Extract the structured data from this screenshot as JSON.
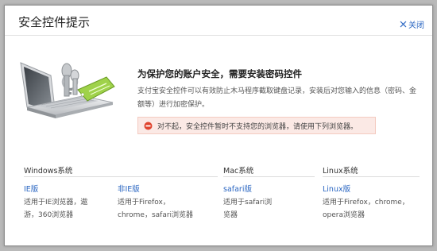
{
  "dialog": {
    "title": "安全控件提示",
    "close_label": "关闭"
  },
  "main": {
    "headline": "为保护您的账户安全，需要安装密码控件",
    "description": "支付宝安全控件可以有效防止木马程序截取键盘记录，安装后对您输入的信息（密码、金额等）进行加密保护。",
    "alert_text": "对不起，安全控件暂时不支持您的浏览器，请使用下列浏览器。"
  },
  "platforms": {
    "windows": {
      "header": "Windows系统",
      "items": [
        {
          "link": "IE版",
          "note": "适用于IE浏览器，遨游，360浏览器"
        },
        {
          "link": "非IE版",
          "note": "适用于Firefox，chrome，safari浏览器"
        }
      ]
    },
    "mac": {
      "header": "Mac系统",
      "items": [
        {
          "link": "safari版",
          "note": "适用于safari浏览器"
        }
      ]
    },
    "linux": {
      "header": "Linux系统",
      "items": [
        {
          "link": "Linux版",
          "note": "适用于Firefox，chrome，opera浏览器"
        }
      ]
    }
  },
  "colors": {
    "link": "#2a66c2",
    "alert_background": "#fbe9e5",
    "alert_icon": "#e0452f",
    "tag_green": "#9fd24a"
  },
  "icons": {
    "close": "close-x-icon",
    "alert": "no-entry-icon",
    "illustration": "laptop-key-tag-illustration"
  }
}
